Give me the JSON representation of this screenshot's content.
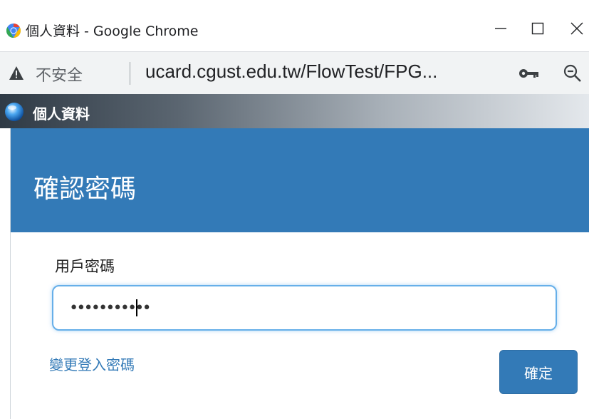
{
  "browser": {
    "window_title": "個人資料 - Google Chrome",
    "security_label": "不安全",
    "url": "ucard.cgust.edu.tw/FlowTest/FPG...",
    "icons": [
      "chrome-logo-icon",
      "minimize-icon",
      "maximize-icon",
      "close-icon",
      "warning-icon",
      "key-icon",
      "zoom-icon"
    ]
  },
  "dialog": {
    "strip_title": "個人資料"
  },
  "modal": {
    "title": "確認密碼",
    "password_label": "用戶密碼",
    "password_value": "•••••••••••",
    "change_password_link": "變更登入密碼",
    "confirm_button": "確定"
  },
  "colors": {
    "primary": "#337ab7",
    "focus_border": "#66afe9"
  }
}
